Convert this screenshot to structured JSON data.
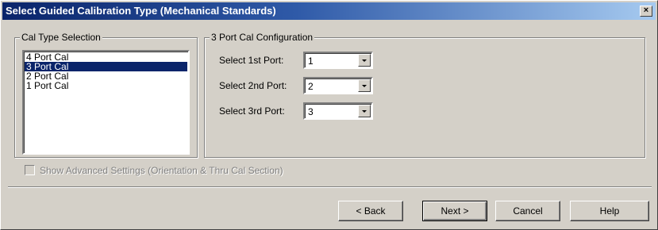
{
  "window": {
    "title": "Select Guided Calibration Type (Mechanical Standards)",
    "close_glyph": "×"
  },
  "cal_type": {
    "group_label": "Cal Type Selection",
    "items": [
      "4 Port Cal",
      "3 Port Cal",
      "2 Port Cal",
      "1 Port Cal"
    ],
    "selected": "3 Port Cal"
  },
  "config": {
    "group_label": "3 Port Cal Configuration",
    "fields": [
      {
        "label": "Select 1st Port:",
        "value": "1"
      },
      {
        "label": "Select 2nd Port:",
        "value": "2"
      },
      {
        "label": "Select 3rd Port:",
        "value": "3"
      }
    ]
  },
  "advanced": {
    "label": "Show Advanced Settings (Orientation & Thru Cal Section)",
    "checked": false,
    "enabled": false
  },
  "buttons": {
    "back": "< Back",
    "next": "Next >",
    "cancel": "Cancel",
    "help": "Help"
  },
  "icons": {
    "close": "close-icon",
    "dropdown": "chevron-down-icon"
  }
}
